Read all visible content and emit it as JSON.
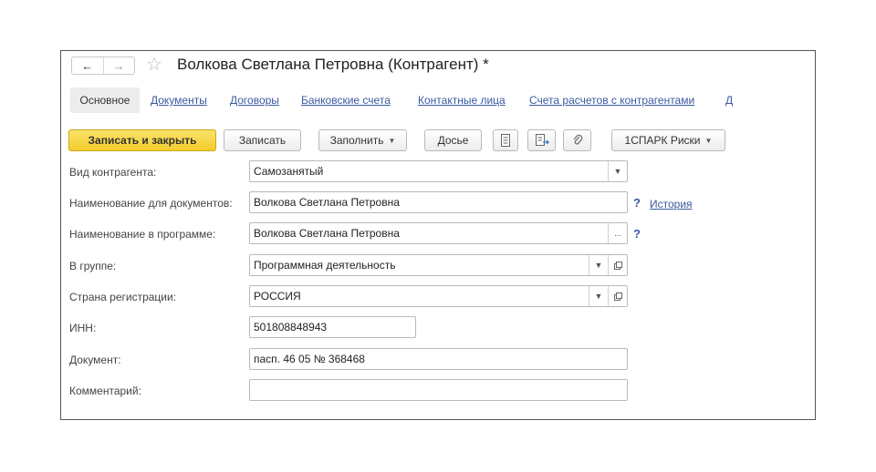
{
  "window": {
    "back_icon": "←",
    "forward_icon": "→",
    "star_icon": "☆",
    "title": "Волкова Светлана Петровна (Контрагент) *"
  },
  "tabs": [
    {
      "label": "Основное",
      "active": true
    },
    {
      "label": "Документы"
    },
    {
      "label": "Договоры"
    },
    {
      "label": "Банковские счета"
    },
    {
      "label": "Контактные лица"
    },
    {
      "label": "Счета расчетов с контрагентами"
    },
    {
      "label": "Д"
    }
  ],
  "toolbar": {
    "save_close": "Записать и закрыть",
    "save": "Записать",
    "fill": "Заполнить",
    "dossier": "Досье",
    "spark": "1СПАРК Риски",
    "dropdown_glyph": "▼"
  },
  "form": {
    "kind": {
      "label": "Вид контрагента:",
      "value": "Самозанятый"
    },
    "doc_name": {
      "label": "Наименование для документов:",
      "value": "Волкова Светлана Петровна",
      "help": "?",
      "history": "История"
    },
    "prog_name": {
      "label": "Наименование в программе:",
      "value": "Волкова Светлана Петровна",
      "select_glyph": "...",
      "help": "?"
    },
    "group": {
      "label": "В группе:",
      "value": "Программная деятельность"
    },
    "country": {
      "label": "Страна регистрации:",
      "value": "РОССИЯ"
    },
    "inn": {
      "label": "ИНН:",
      "value": "501808848943"
    },
    "document": {
      "label": "Документ:",
      "value": "пасп. 46 05 № 368468"
    },
    "comment": {
      "label": "Комментарий:",
      "value": ""
    }
  },
  "colors": {
    "primary_button": "#f3cd2c",
    "link": "#3a5aa0",
    "frame_border": "#555555"
  }
}
